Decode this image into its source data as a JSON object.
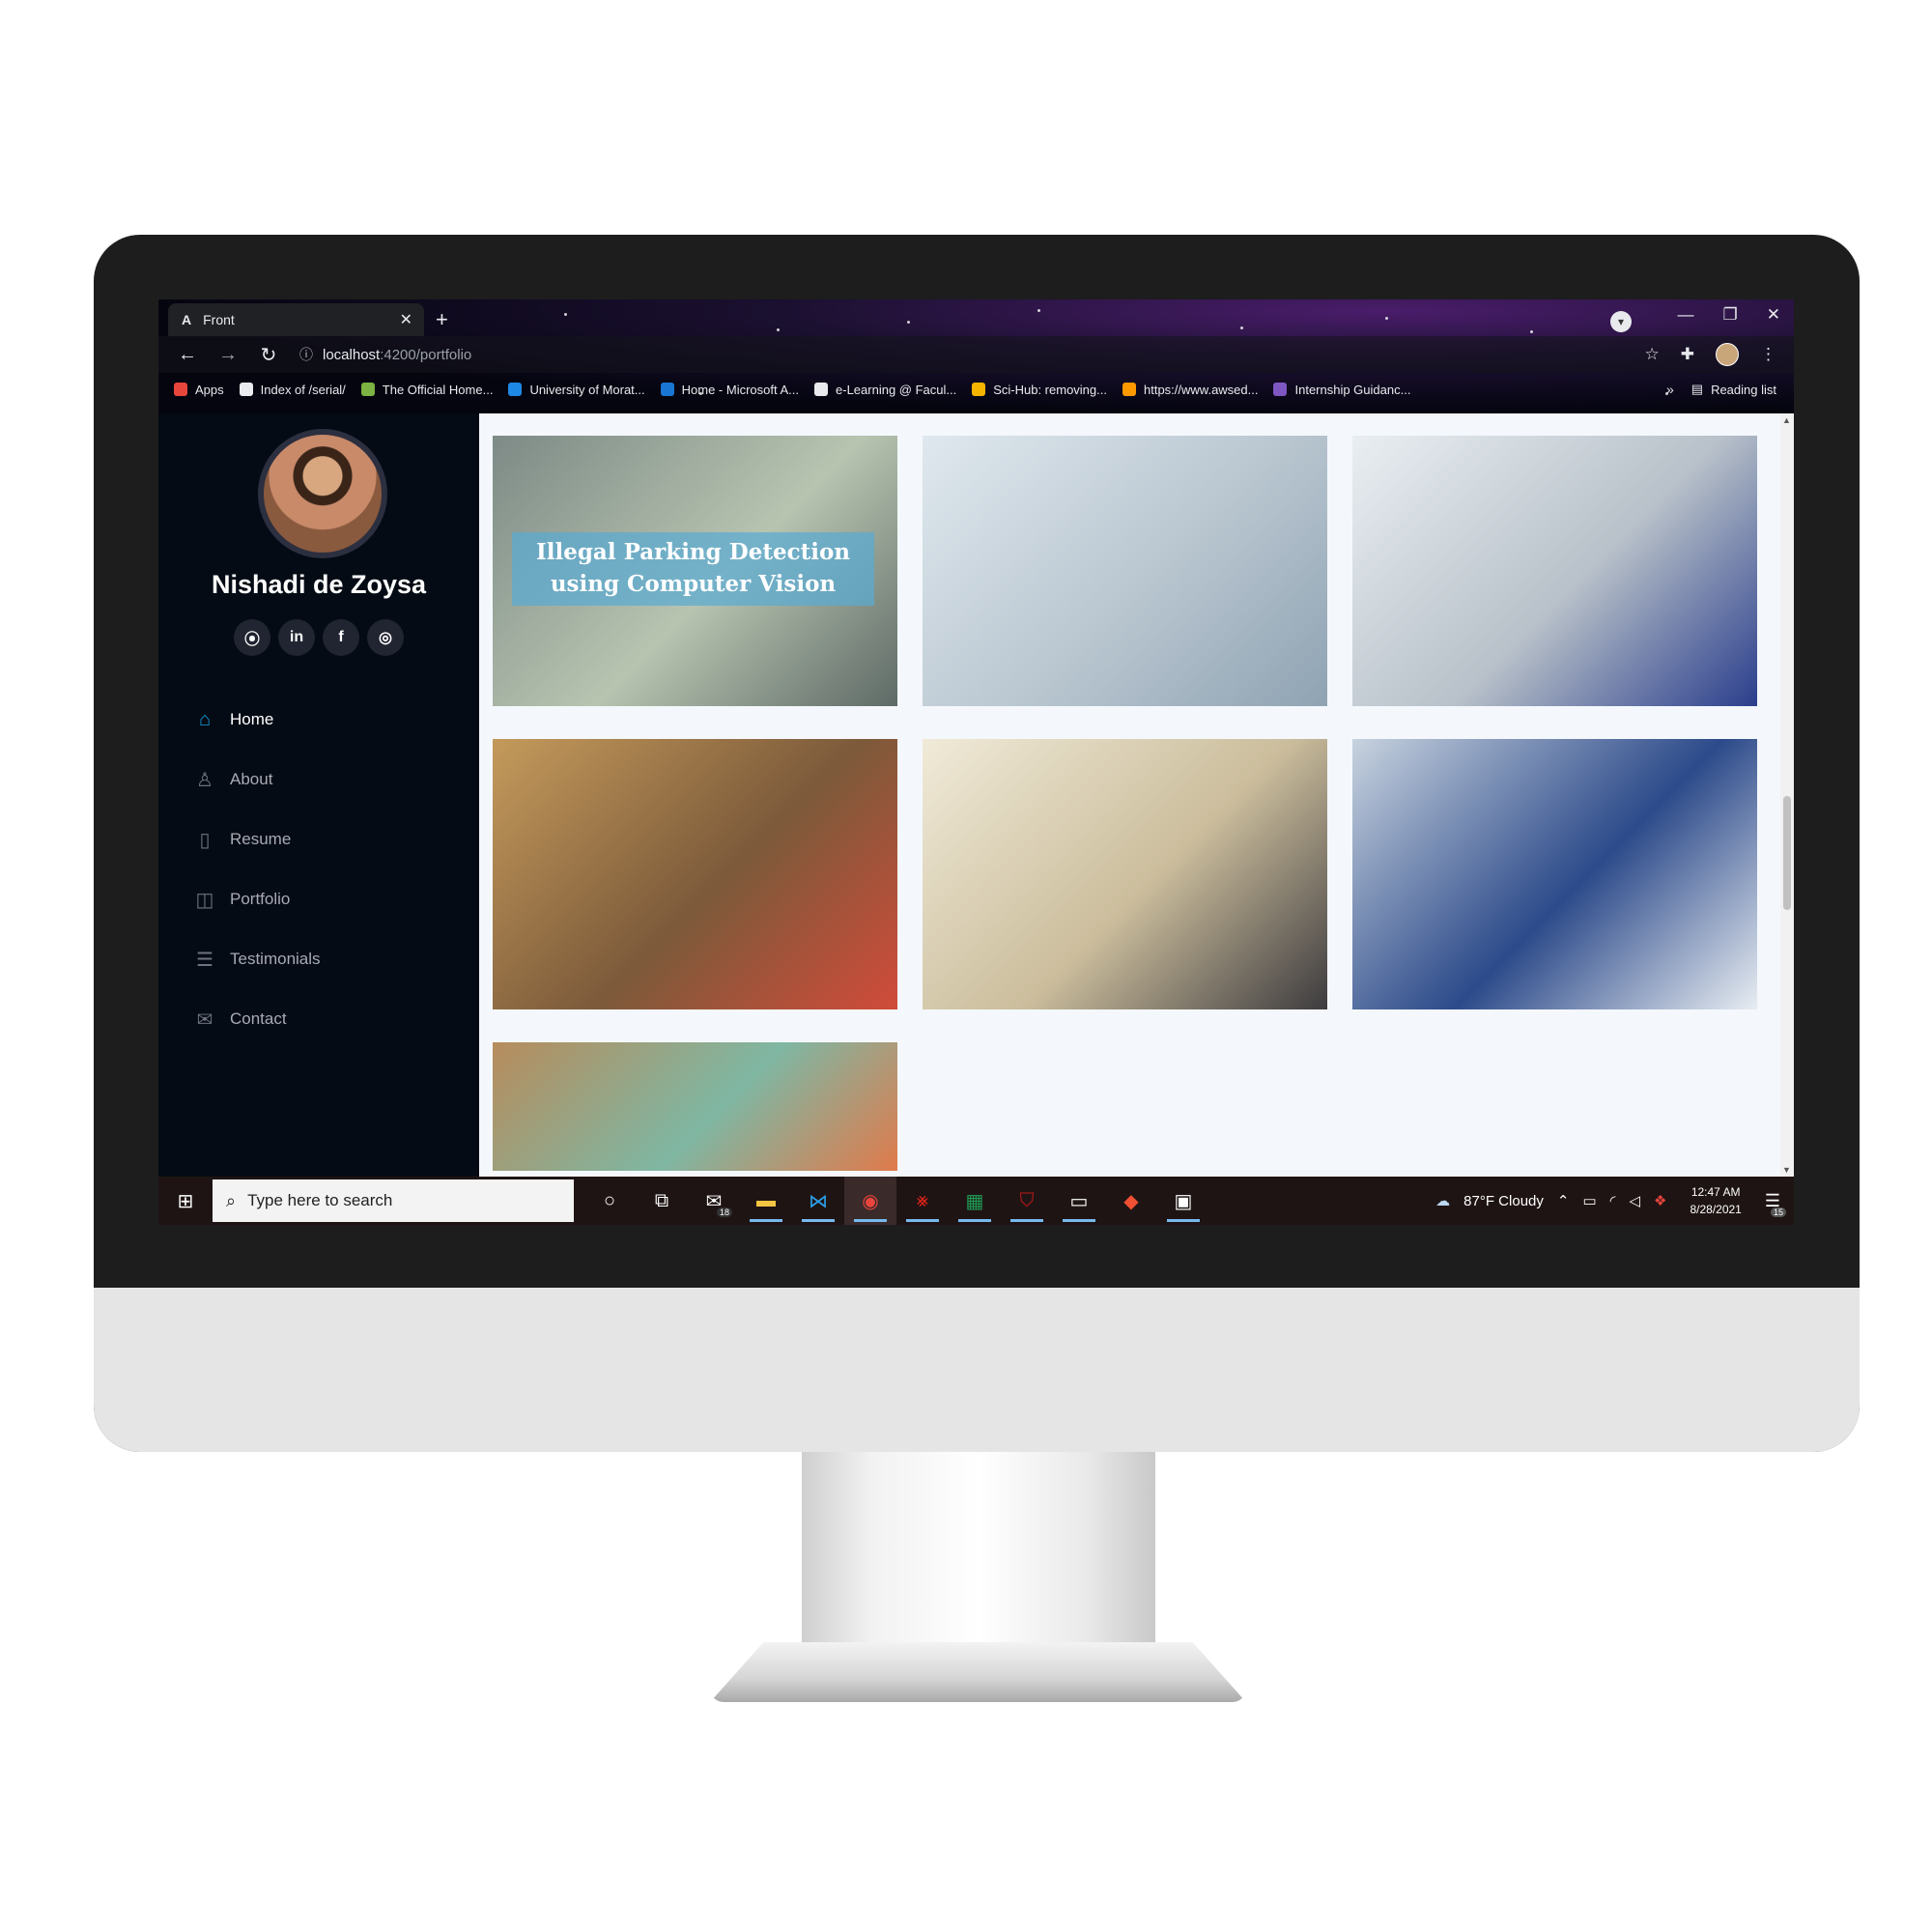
{
  "browser": {
    "tab_title": "Front",
    "tab_icon": "A",
    "url_host": "localhost",
    "url_rest": ":4200/portfolio",
    "bookmarks": [
      {
        "label": "Apps",
        "icon": "apps-grid-icon",
        "color": "#e8453c"
      },
      {
        "label": "Index of /serial/",
        "icon": "globe-icon",
        "color": "#e8eaed"
      },
      {
        "label": "The Official Home...",
        "icon": "site-icon",
        "color": "#7cb342"
      },
      {
        "label": "University of Morat...",
        "icon": "uom-icon",
        "color": "#1e88e5"
      },
      {
        "label": "Home - Microsoft A...",
        "icon": "azure-icon",
        "color": "#1976d2"
      },
      {
        "label": "e-Learning @ Facul...",
        "icon": "globe-icon",
        "color": "#e8eaed"
      },
      {
        "label": "Sci-Hub: removing...",
        "icon": "scihub-icon",
        "color": "#f4b400"
      },
      {
        "label": "https://www.awsed...",
        "icon": "aws-icon",
        "color": "#ff9900"
      },
      {
        "label": "Internship Guidanc...",
        "icon": "forms-icon",
        "color": "#7e57c2"
      }
    ],
    "more_bookmarks": "»",
    "reading_list": "Reading list"
  },
  "sidebar": {
    "name": "Nishadi de Zoysa",
    "socials": [
      {
        "name": "github",
        "glyph": "⦿"
      },
      {
        "name": "linkedin",
        "glyph": "in"
      },
      {
        "name": "facebook",
        "glyph": "f"
      },
      {
        "name": "instagram",
        "glyph": "◎"
      }
    ],
    "menu": [
      {
        "label": "Home",
        "icon": "home-icon",
        "active": true
      },
      {
        "label": "About",
        "icon": "user-icon",
        "active": false
      },
      {
        "label": "Resume",
        "icon": "file-icon",
        "active": false
      },
      {
        "label": "Portfolio",
        "icon": "book-icon",
        "active": false
      },
      {
        "label": "Testimonials",
        "icon": "server-icon",
        "active": false
      },
      {
        "label": "Contact",
        "icon": "envelope-icon",
        "active": false
      }
    ]
  },
  "portfolio": {
    "items": [
      {
        "image": "illegal-parking-street",
        "overlay_title": "Illegal Parking Detection using Computer Vision",
        "colors": [
          "#7d8a86",
          "#b7c4b0",
          "#5e6a66"
        ]
      },
      {
        "image": "woman-writing-at-desk",
        "overlay_title": "",
        "colors": [
          "#dfe8ee",
          "#b9c6d0",
          "#8fa3b3"
        ]
      },
      {
        "image": "stethoscope-on-laptop",
        "overlay_title": "",
        "colors": [
          "#e9eef2",
          "#b8c1c9",
          "#2b3e8c"
        ]
      },
      {
        "image": "supermarket-checkout",
        "overlay_title": "",
        "colors": [
          "#c49a5b",
          "#7c5a3a",
          "#d14b3a"
        ]
      },
      {
        "image": "business-handshake",
        "overlay_title": "",
        "colors": [
          "#f0ead8",
          "#cbbd9c",
          "#3d3b3e"
        ]
      },
      {
        "image": "robot-factory-tablet",
        "overlay_title": "",
        "colors": [
          "#c8d3df",
          "#2c4a8a",
          "#e8edf2"
        ]
      },
      {
        "image": "design-desk-color-swatches",
        "overlay_title": "",
        "colors": [
          "#b78c5c",
          "#7fb7a3",
          "#e07a4b"
        ]
      }
    ]
  },
  "taskbar": {
    "search_placeholder": "Type here to search",
    "mail_badge": "18",
    "weather": "87°F  Cloudy",
    "time": "12:47 AM",
    "date": "8/28/2021",
    "notification_count": "15"
  }
}
